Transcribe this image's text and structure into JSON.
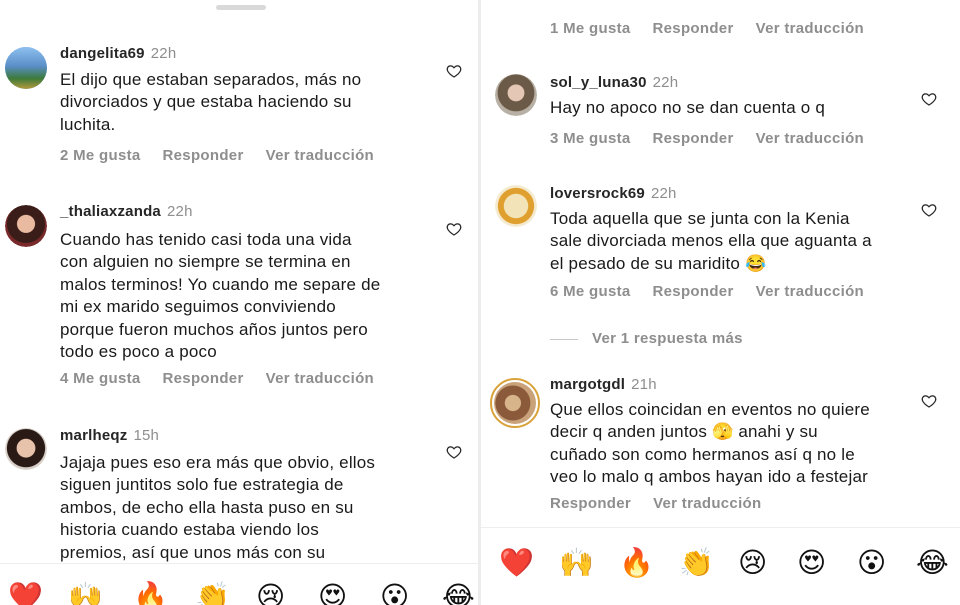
{
  "colors": {
    "muted": "#8e8e8e",
    "text": "#1a1a1a",
    "heart": "#e0245e"
  },
  "left": {
    "comments": [
      {
        "user": "dangelita69",
        "time": "22h",
        "lines": [
          "El dijo que estaban separados, más no",
          "divorciados y que estaba haciendo su",
          "luchita."
        ],
        "likes": "2 Me gusta",
        "reply": "Responder",
        "translate": "Ver traducción"
      },
      {
        "user": "_thaliaxzanda",
        "time": "22h",
        "lines": [
          "Cuando has tenido casi toda una vida",
          "con alguien no siempre se termina en",
          "malos terminos! Yo cuando me separe de",
          "mi ex marido seguimos conviviendo",
          "porque fueron muchos años juntos pero",
          "todo es poco a poco"
        ],
        "likes": "4 Me gusta",
        "reply": "Responder",
        "translate": "Ver traducción"
      },
      {
        "user": "marlheqz",
        "time": "15h",
        "lines": [
          "Jajaja pues eso era más que obvio, ellos",
          "siguen juntitos solo fue estrategia de",
          "ambos, de echo ella hasta puso en su",
          "historia cuando estaba viendo los",
          "premios, así que unos más con su"
        ]
      }
    ],
    "emojis": [
      "❤️",
      "🙌",
      "🔥",
      "👏",
      "😢",
      "😍",
      "😮",
      "😂"
    ]
  },
  "right": {
    "top_actions": {
      "likes": "1 Me gusta",
      "reply": "Responder",
      "translate": "Ver traducción"
    },
    "comments": [
      {
        "user": "sol_y_luna30",
        "time": "22h",
        "lines": [
          "Hay no apoco no se dan cuenta o q"
        ],
        "likes": "3 Me gusta",
        "reply": "Responder",
        "translate": "Ver traducción"
      },
      {
        "user": "loversrock69",
        "time": "22h",
        "lines": [
          "Toda aquella que se junta con la Kenia",
          "sale divorciada menos ella que aguanta a",
          "el pesado de su maridito 😂"
        ],
        "likes": "6 Me gusta",
        "reply": "Responder",
        "translate": "Ver traducción"
      },
      {
        "user": "margotgdl",
        "time": "21h",
        "lines": [
          "Que ellos coincidan en eventos no quiere",
          "decir q anden juntos 🫣 anahi y su",
          "cuñado son como hermanos así q no le",
          "veo lo malo q ambos hayan ido a festejar"
        ],
        "reply": "Responder",
        "translate": "Ver traducción"
      }
    ],
    "more_replies": "Ver 1 respuesta más",
    "emojis": [
      "❤️",
      "🙌",
      "🔥",
      "👏",
      "😢",
      "😍",
      "😮",
      "😂"
    ]
  }
}
